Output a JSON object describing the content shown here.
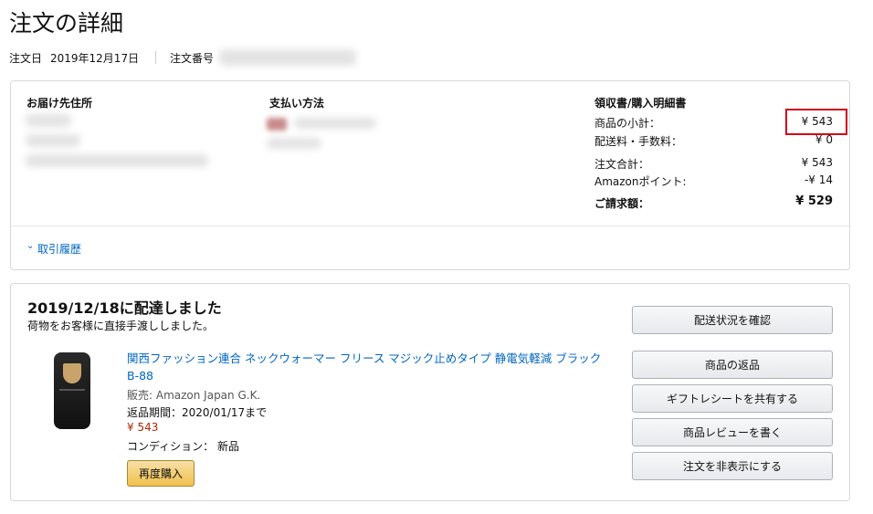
{
  "page": {
    "title": "注文の詳細",
    "order_date_label": "注文日",
    "order_date": "2019年12月17日",
    "order_number_label": "注文番号"
  },
  "order_box": {
    "shipping_header": "お届け先住所",
    "payment_header": "支払い方法",
    "receipt_header": "領収書/購入明細書",
    "summary": [
      {
        "label": "商品の小計：",
        "value": "¥ 543"
      },
      {
        "label": "配送料・手数料：",
        "value": "¥ 0"
      },
      {
        "label": "注文合計：",
        "value": "¥ 543"
      },
      {
        "label": "Amazonポイント:",
        "value": "-¥ 14"
      }
    ],
    "grand_total_label": "ご請求額：",
    "grand_total_value": "¥ 529",
    "history_link": "取引履歴",
    "highlight_color": "#d0021b"
  },
  "shipment": {
    "status_title": "2019/12/18に配達しました",
    "status_detail": "荷物をお客様に直接手渡ししました。",
    "product": {
      "title": "関西ファッション連合 ネックウォーマー フリース マジック止めタイプ 静電気軽減 ブラック B-88",
      "seller": "販売: Amazon Japan G.K.",
      "return_period": "返品期間：2020/01/17まで",
      "price": "¥ 543",
      "condition": "コンディション： 新品",
      "buy_again": "再度購入"
    },
    "buttons": {
      "track": "配送状況を確認",
      "return": "商品の返品",
      "gift": "ギフトレシートを共有する",
      "review": "商品レビューを書く",
      "hide": "注文を非表示にする"
    }
  },
  "colors": {
    "link": "#0066c0",
    "price": "#b12704",
    "button_yellow": "#f0c14b"
  }
}
